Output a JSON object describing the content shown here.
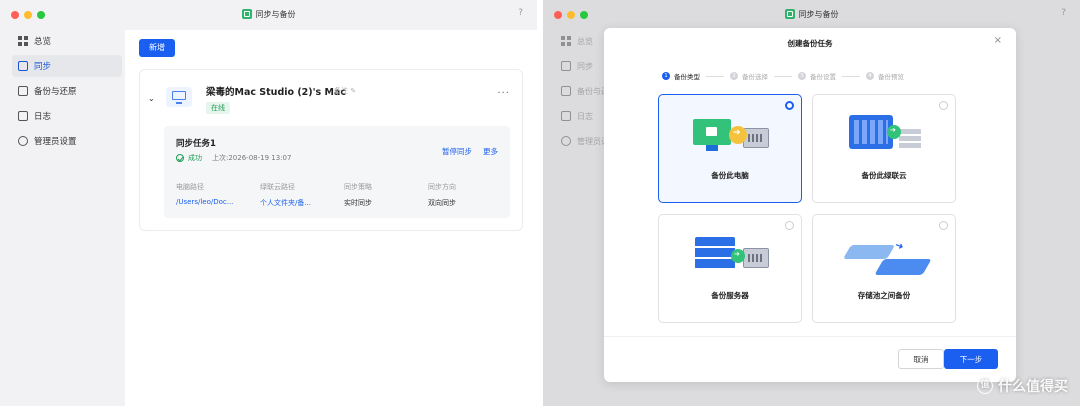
{
  "app": {
    "title": "同步与备份",
    "help": "?"
  },
  "sidebar": {
    "items": [
      {
        "label": "总览",
        "icon": "grid-icon"
      },
      {
        "label": "同步",
        "icon": "sync-icon"
      },
      {
        "label": "备份与还原",
        "icon": "backup-icon"
      },
      {
        "label": "日志",
        "icon": "log-icon"
      },
      {
        "label": "管理员设置",
        "icon": "gear-icon"
      }
    ]
  },
  "sidebar_dim": {
    "items": [
      {
        "label": "总览"
      },
      {
        "label": "同步"
      },
      {
        "label": "备份与还"
      },
      {
        "label": "日志"
      },
      {
        "label": "管理员设"
      }
    ]
  },
  "left": {
    "new_button": "新增",
    "device": {
      "name": "梁毒的Mac Studio (2)'s Mac",
      "note": "备注",
      "status": "在线",
      "more": "···"
    },
    "task": {
      "name": "同步任务1",
      "status": "成功",
      "last_sync": "上次:2026-08-19 13:07",
      "pause": "暂停同步",
      "more": "更多",
      "fields": [
        {
          "key": "电脑路径",
          "value": "/Users/leo/Doc..."
        },
        {
          "key": "绿联云路径",
          "value": "个人文件夹/备..."
        },
        {
          "key": "同步策略",
          "value": "实时同步"
        },
        {
          "key": "同步方向",
          "value": "双向同步"
        }
      ]
    }
  },
  "modal": {
    "title": "创建备份任务",
    "close": "×",
    "steps": [
      {
        "num": "1",
        "label": "备份类型"
      },
      {
        "num": "2",
        "label": "备份选择"
      },
      {
        "num": "3",
        "label": "备份设置"
      },
      {
        "num": "4",
        "label": "备份预览"
      }
    ],
    "options": [
      {
        "label": "备份此电脑",
        "selected": true
      },
      {
        "label": "备份此绿联云",
        "selected": false
      },
      {
        "label": "备份服务器",
        "selected": false
      },
      {
        "label": "存储池之间备份",
        "selected": false
      }
    ],
    "cancel": "取消",
    "next": "下一步"
  },
  "watermark": {
    "badge": "值",
    "text": "什么值得买"
  },
  "colors": {
    "accent": "#1a5ff0",
    "success": "#1f9d55"
  }
}
